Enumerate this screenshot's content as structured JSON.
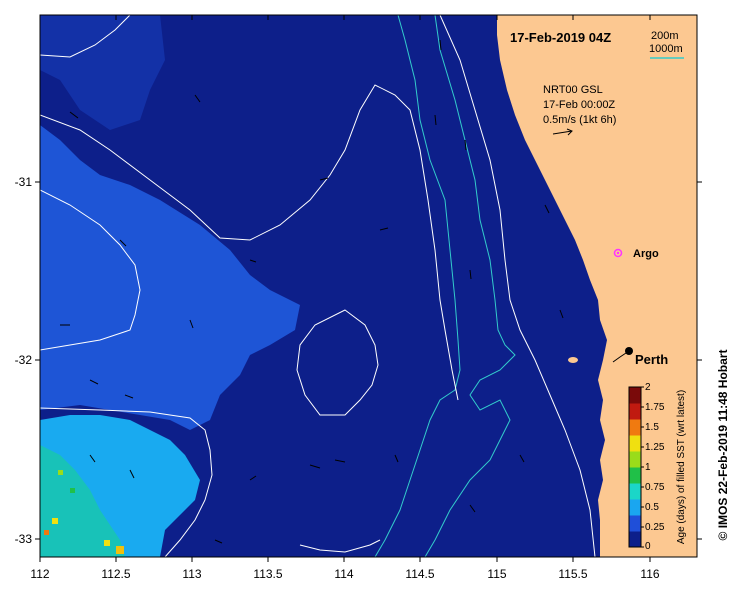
{
  "title": "17-Feb-2019 04Z",
  "isobath_legend": {
    "label1": "200m",
    "label2": "1000m",
    "line_color": "#33cccc"
  },
  "current_info": {
    "line1": "NRT00 GSL",
    "line2": "17-Feb 00:00Z",
    "line3": "0.5m/s (1kt 6h)"
  },
  "argo_label": "Argo",
  "city_label": "Perth",
  "credit": "© IMOS 22-Feb-2019 11:48 Hobart",
  "colorbar": {
    "label": "Age (days) of filled SST (wrt latest)",
    "ticks": [
      "0",
      "0.25",
      "0.5",
      "0.75",
      "1",
      "1.25",
      "1.5",
      "1.75",
      "2"
    ],
    "colors": [
      "#0d1f8a",
      "#1f4fd9",
      "#1aa6f0",
      "#1bd6c8",
      "#20c048",
      "#9adc1a",
      "#f0e010",
      "#f07a10",
      "#c01a10",
      "#7a0a0a"
    ]
  },
  "axes": {
    "x_ticks": [
      "112",
      "112.5",
      "113",
      "113.5",
      "114",
      "114.5",
      "115",
      "115.5",
      "116"
    ],
    "y_ticks": [
      "-31",
      "-32",
      "-33"
    ],
    "x_range": [
      112,
      116.3
    ],
    "y_range": [
      -33.1,
      -30.1
    ]
  },
  "colors": {
    "deep": "#0d1f8a",
    "mid": "#1e55d6",
    "light": "#19aaf0",
    "teal": "#18c2b8",
    "land": "#fcc891",
    "contour": "#ffffff",
    "isobath": "#33cccc"
  }
}
